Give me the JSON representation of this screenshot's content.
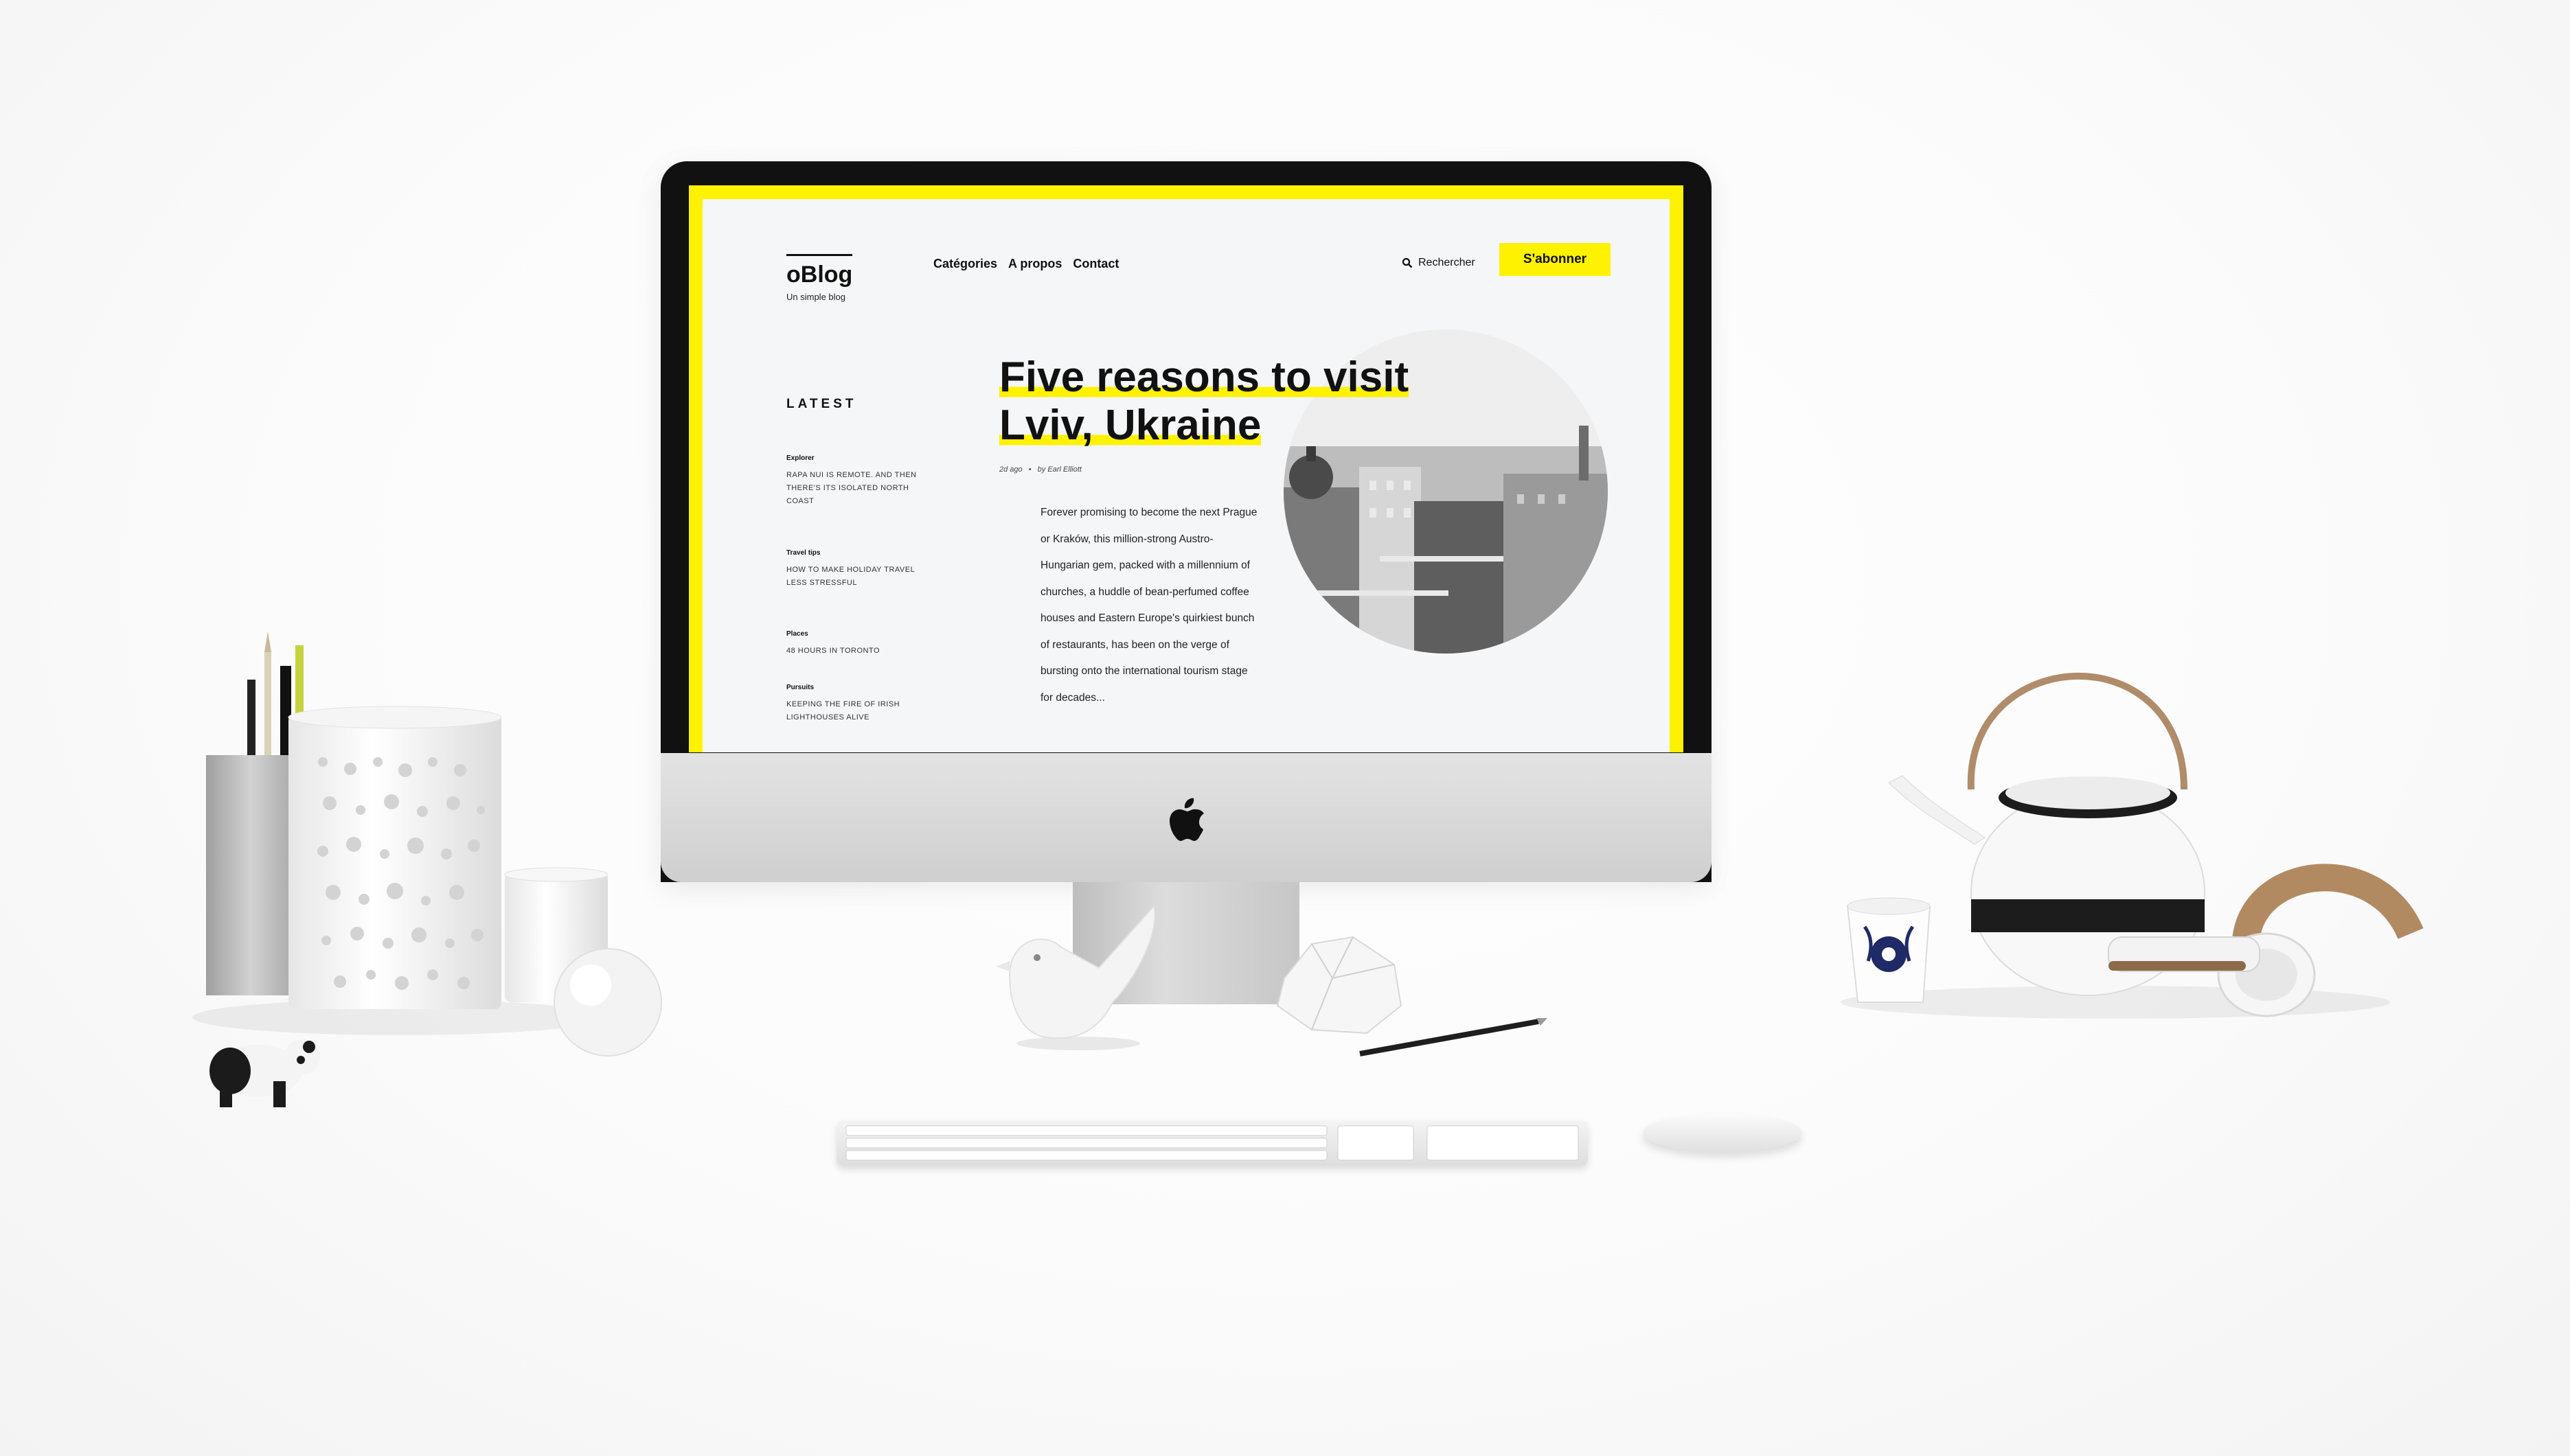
{
  "blog": {
    "logo_title": "oBlog",
    "logo_tagline": "Un simple blog",
    "nav": [
      "Catégories",
      "A propos",
      "Contact"
    ],
    "search_label": "Rechercher",
    "subscribe_label": "S'abonner",
    "accent_color": "#fff200",
    "sidebar": {
      "heading": "LATEST",
      "items": [
        {
          "category": "Explorer",
          "title": "RAPA NUI IS REMOTE. AND THEN THERE'S ITS ISOLATED NORTH COAST"
        },
        {
          "category": "Travel tips",
          "title": "HOW TO MAKE HOLIDAY TRAVEL LESS STRESSFUL"
        },
        {
          "category": "Places",
          "title": "48 HOURS IN TORONTO"
        },
        {
          "category": "Pursuits",
          "title": "KEEPING THE FIRE OF IRISH LIGHTHOUSES ALIVE"
        }
      ]
    },
    "article": {
      "title_line1": "Five reasons to visit",
      "title_line2": "Lviv, Ukraine",
      "meta_age": "2d ago",
      "meta_sep": "•",
      "meta_author": "by Earl Elliott",
      "excerpt": "Forever promising to become the next Prague or Kraków, this million-strong Austro-Hungarian gem, packed with a millennium of churches, a huddle of bean-perfumed coffee houses and Eastern Europe's quirkiest bunch of restaurants, has been on the verge of bursting onto the international tourism stage for decades..."
    }
  },
  "scene": {
    "icons": [
      "search-icon",
      "apple-logo-icon"
    ]
  }
}
